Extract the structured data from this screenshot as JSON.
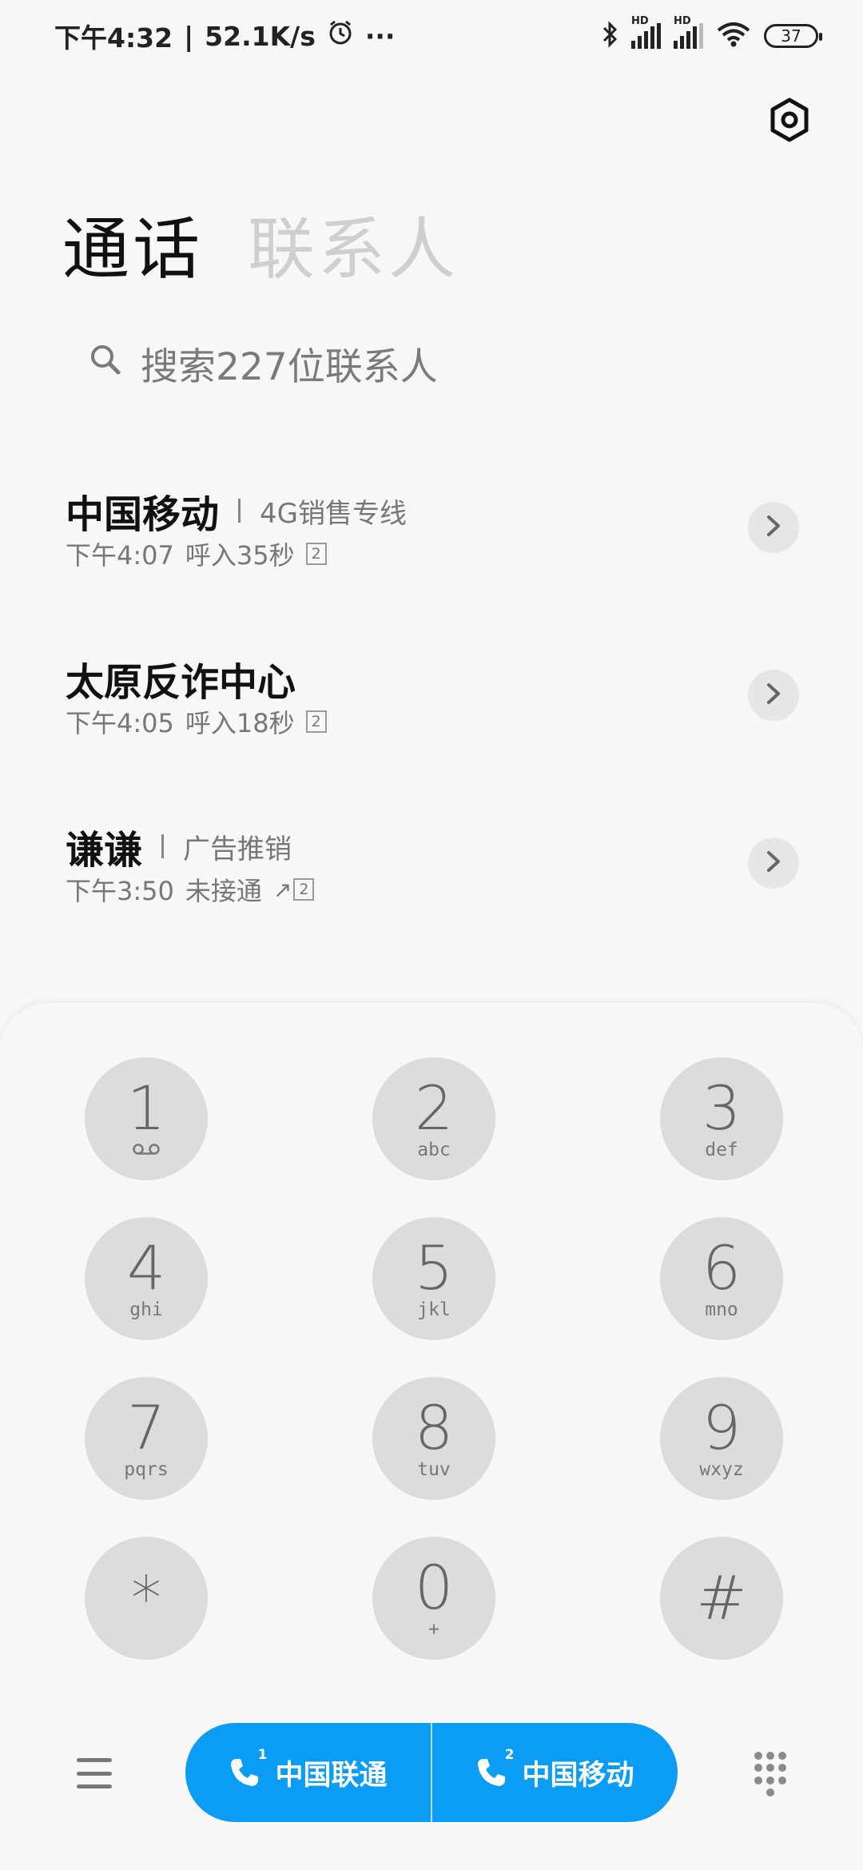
{
  "status_bar": {
    "time": "下午4:32",
    "net_speed": "52.1K/s",
    "separator": "|",
    "more": "···",
    "hd": "HD",
    "battery": "37"
  },
  "tabs": [
    {
      "label": "通话",
      "active": true
    },
    {
      "label": "联系人",
      "active": false
    }
  ],
  "search": {
    "placeholder": "搜索227位联系人"
  },
  "call_log": [
    {
      "name": "中国移动",
      "tag": "4G销售专线",
      "time": "下午4:07",
      "detail": "呼入35秒",
      "sim": "2",
      "outgoing": false
    },
    {
      "name": "太原反诈中心",
      "tag": "",
      "time": "下午4:05",
      "detail": "呼入18秒",
      "sim": "2",
      "outgoing": false
    },
    {
      "name": "谦谦",
      "tag": "广告推销",
      "time": "下午3:50",
      "detail": "未接通",
      "sim": "2",
      "outgoing": true,
      "outgoing_arrow": "↗"
    }
  ],
  "dialpad": [
    {
      "digit": "1",
      "letters": ""
    },
    {
      "digit": "2",
      "letters": "abc"
    },
    {
      "digit": "3",
      "letters": "def"
    },
    {
      "digit": "4",
      "letters": "ghi"
    },
    {
      "digit": "5",
      "letters": "jkl"
    },
    {
      "digit": "6",
      "letters": "mno"
    },
    {
      "digit": "7",
      "letters": "pqrs"
    },
    {
      "digit": "8",
      "letters": "tuv"
    },
    {
      "digit": "9",
      "letters": "wxyz"
    },
    {
      "digit": "*",
      "letters": ""
    },
    {
      "digit": "0",
      "letters": "+"
    },
    {
      "digit": "#",
      "letters": ""
    }
  ],
  "call_buttons": [
    {
      "sim": "1",
      "label": "中国联通"
    },
    {
      "sim": "2",
      "label": "中国移动"
    }
  ],
  "colors": {
    "accent": "#0b9cf5",
    "key_bg": "#dcdcdc",
    "background": "#f7f7f7"
  }
}
